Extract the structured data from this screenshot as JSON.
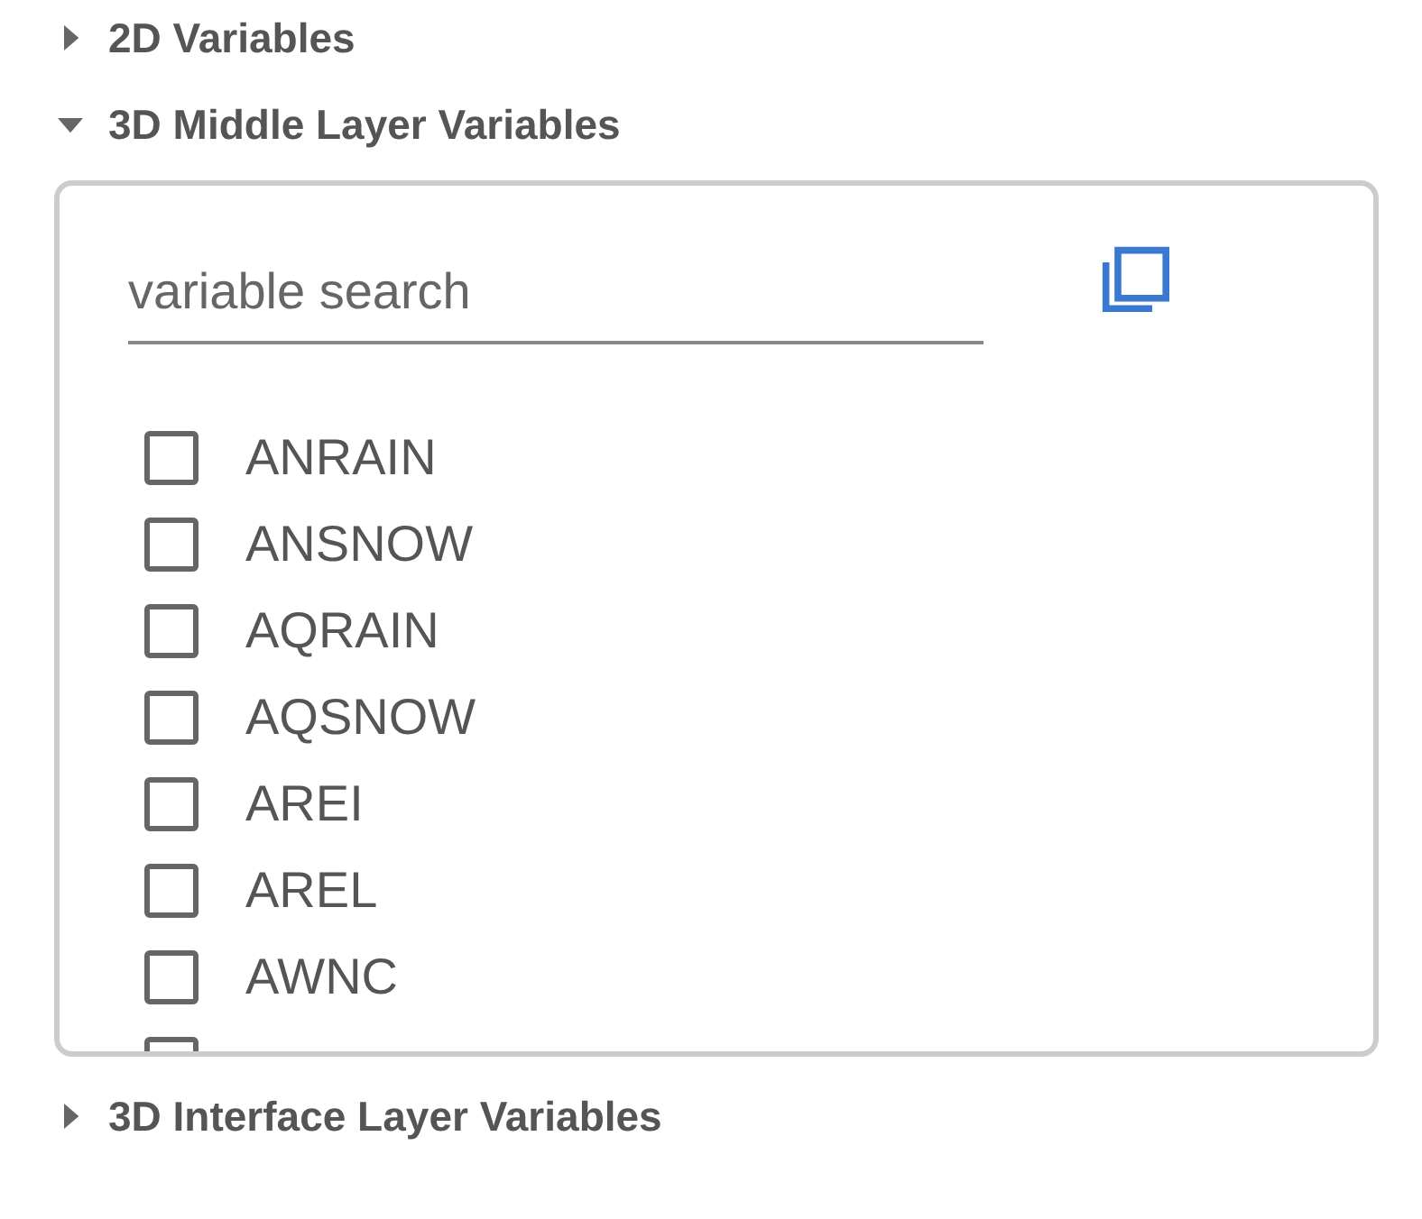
{
  "sections": [
    {
      "title": "2D Variables",
      "expanded": false
    },
    {
      "title": "3D Middle Layer Variables",
      "expanded": true,
      "search": {
        "placeholder": "variable search"
      },
      "variables": [
        {
          "name": "ANRAIN",
          "checked": false
        },
        {
          "name": "ANSNOW",
          "checked": false
        },
        {
          "name": "AQRAIN",
          "checked": false
        },
        {
          "name": "AQSNOW",
          "checked": false
        },
        {
          "name": "AREI",
          "checked": false
        },
        {
          "name": "AREL",
          "checked": false
        },
        {
          "name": "AWNC",
          "checked": false
        },
        {
          "checked": false
        }
      ]
    },
    {
      "title": "3D Interface Layer Variables",
      "expanded": false
    }
  ]
}
